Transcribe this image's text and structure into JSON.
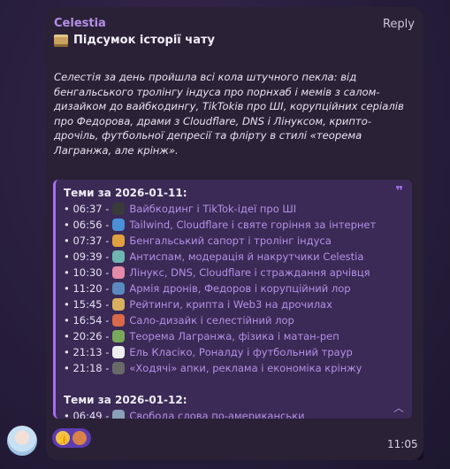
{
  "message": {
    "sender": "Celestia",
    "reply_label": "Reply",
    "title": "Підсумок історії чату",
    "summary": "Селестія за день пройшла всі кола штучного пекла: від бенгальського тролінгу індуса про порнхаб і мемів з салом-дизайком до вайбкодингу, TikTokів про ШІ, корупційних серіалів про Федорова, драми з Cloudflare, DNS і Лінуксом, крипто-дрочіль, футбольної депресії та флірту в стилі «теорема Лагранжа, але крінж».",
    "time": "11:05"
  },
  "quote": {
    "mark": "❞",
    "days": [
      {
        "heading": "Теми за 2026-01-11:",
        "topics": [
          {
            "time": "• 06:37 -",
            "text": "Вайбкодинг і TikTok-ідеї про ШІ",
            "emoji_color": "#3a3a3a"
          },
          {
            "time": "• 06:56 -",
            "text": "Tailwind, Cloudflare і святе горіння за інтернет",
            "emoji_color": "#4a90d9"
          },
          {
            "time": "• 07:37 -",
            "text": "Бенгальський сапорт і тролінг індуса",
            "emoji_color": "#e0a040"
          },
          {
            "time": "• 09:39 -",
            "text": "Антиспам, модерація й накрутчики Celestia",
            "emoji_color": "#6fb6b0"
          },
          {
            "time": "• 10:30 -",
            "text": "Лінукс, DNS, Cloudflare і страждання арчівця",
            "emoji_color": "#e48aa8"
          },
          {
            "time": "• 11:20 -",
            "text": "Армія дронів, Федоров і корупційний лор",
            "emoji_color": "#5a8ac0"
          },
          {
            "time": "• 15:45 -",
            "text": "Рейтинги, крипта і Web3 на дрочилах",
            "emoji_color": "#d8b060"
          },
          {
            "time": "• 16:54 -",
            "text": "Сало-дизайк і селестійний лор",
            "emoji_color": "#d9694a"
          },
          {
            "time": "• 20:26 -",
            "text": "Теорема Лагранжа, фізика і матан-реп",
            "emoji_color": "#7aa85a"
          },
          {
            "time": "• 21:13 -",
            "text": "Ель Класіко, Роналду і футбольний траур",
            "emoji_color": "#eeeeee"
          },
          {
            "time": "• 21:18 -",
            "text": "«Ходячі» апки, реклама і економіка крінжу",
            "emoji_color": "#6a6a6a"
          }
        ]
      },
      {
        "heading": "Теми за 2026-01-12:",
        "topics": [
          {
            "time": "• 06:49 -",
            "text": "Свобода слова по-американськи",
            "emoji_color": "#8aa0b8"
          }
        ]
      }
    ]
  },
  "reaction": {
    "emoji": "👍"
  }
}
